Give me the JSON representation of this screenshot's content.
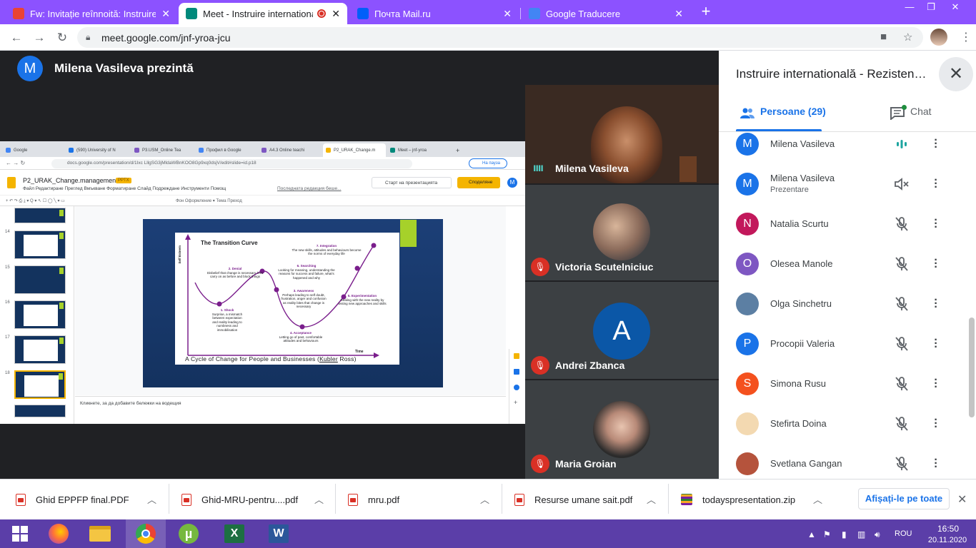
{
  "browser": {
    "tabs": [
      {
        "title": "Fw: Invitație reînnoită: Instruire in",
        "favicon_color": "#ea4335",
        "active": false
      },
      {
        "title": "Meet - Instruire international",
        "favicon_color": "#00897b",
        "active": true
      },
      {
        "title": "Почта Mail.ru",
        "favicon_color": "#005ff9",
        "active": false
      },
      {
        "title": "Google Traducere",
        "favicon_color": "#4285f4",
        "active": false
      }
    ],
    "url": "meet.google.com/jnf-yroa-jcu"
  },
  "meet": {
    "presenter_initial": "M",
    "presenter_label": "Milena Vasileva prezintă",
    "meeting_title": "Instruire internatională - Rezisten…",
    "tab_people": "Persoane (29)",
    "tab_chat": "Chat",
    "tiles": [
      {
        "name": "Milena Vasileva",
        "muted": false
      },
      {
        "name": "Victoria Scutelniciuc",
        "muted": true
      },
      {
        "name": "Andrei Zbanca",
        "muted": true,
        "initial": "A"
      },
      {
        "name": "Maria Groian",
        "muted": true
      }
    ],
    "participants": [
      {
        "name": "Milena Vasileva",
        "initial": "M",
        "color": "#1a73e8",
        "mic": "speaking"
      },
      {
        "name": "Milena Vasileva",
        "sub": "Prezentare",
        "initial": "M",
        "color": "#1a73e8",
        "mic": "presentation"
      },
      {
        "name": "Natalia Scurtu",
        "initial": "N",
        "color": "#c2185b",
        "mic": "muted"
      },
      {
        "name": "Olesea Manole",
        "initial": "O",
        "color": "#7e57c2",
        "mic": "muted"
      },
      {
        "name": "Olga Sinchetru",
        "initial": "",
        "color": "#5c7fa3",
        "mic": "muted"
      },
      {
        "name": "Procopii Valeria",
        "initial": "P",
        "color": "#1a73e8",
        "mic": "muted"
      },
      {
        "name": "Simona Rusu",
        "initial": "S",
        "color": "#f4511e",
        "mic": "muted"
      },
      {
        "name": "Stefirta Doina",
        "initial": "",
        "color": "#f3d9b1",
        "mic": "muted"
      },
      {
        "name": "Svetlana Gangan",
        "initial": "",
        "color": "#b5533c",
        "mic": "muted"
      }
    ]
  },
  "shared_screen": {
    "tabs": [
      "Google",
      "(590) University of N",
      "P3.USM_Online Tea",
      "Профил в Google",
      "A4.3 Online teachi",
      "P2_URAK_Change.m",
      "Meet – jnf-yroa"
    ],
    "url": "docs.google.com/presentation/d/1Ixc LllgSG3jMldaWBnKOO8Gp9xq0dsjV/edit#slide=id.p18",
    "pause_label": "На пауза",
    "doc_name": "P2_URAK_Change.management",
    "doc_badge": "PPTX",
    "menus": "Файл   Редактиране   Преглед   Вмъкване   Форматиране   Слайд   Подреждане   Инструменти   Помощ",
    "last_edit": "Последната редакция беше...",
    "present_label": "Старт на презентацията",
    "share_label": "Споделяне",
    "account_initial": "M",
    "toolbar_items": "Фон     Оформление ▾     Тема     Преход",
    "thumb_numbers": [
      "14",
      "15",
      "16",
      "17",
      "18"
    ],
    "notes_hint": "Кликнете, за да добавите бележки на водещия",
    "slide": {
      "title": "The Transition Curve",
      "y_axis": "Self Esteem",
      "x_axis": "Time",
      "caption_prefix": "A Cycle of Change for People and Businesses (",
      "caption_link": "Kubler",
      "caption_suffix": " Ross)",
      "stages": [
        {
          "label": "1. Shock",
          "text": "Surprise, a mismatch between expectation and reality leading to numbness and immobilisation"
        },
        {
          "label": "2. Denial",
          "text": "Disbelief that change is necessary, let's carry on as before and block things"
        },
        {
          "label": "3. Awareness",
          "text": "Perhaps leading to self doubt, frustration, anger and confusion as reality bites that change is necessary"
        },
        {
          "label": "4. Acceptance",
          "text": "Letting go of past, comfortable attitudes and behaviours"
        },
        {
          "label": "5. Experimentation",
          "text": "Dealing with the new reality by testing new approaches and skills"
        },
        {
          "label": "6. Searching",
          "text": "Looking for meaning, understanding the reasons for success and failure, what's happened and why"
        },
        {
          "label": "7. Integration",
          "text": "The new skills, attitudes and behaviours become the norms of everyday life"
        }
      ]
    }
  },
  "downloads": {
    "items": [
      {
        "name": "Ghid EPPFP final.PDF",
        "type": "pdf"
      },
      {
        "name": "Ghid-MRU-pentru....pdf",
        "type": "pdf"
      },
      {
        "name": "mru.pdf",
        "type": "pdf"
      },
      {
        "name": "Resurse umane sait.pdf",
        "type": "pdf"
      },
      {
        "name": "todayspresentation.zip",
        "type": "zip"
      }
    ],
    "show_all": "Afișați-le pe toate"
  },
  "taskbar": {
    "lang": "ROU",
    "time": "16:50",
    "date": "20.11.2020"
  }
}
